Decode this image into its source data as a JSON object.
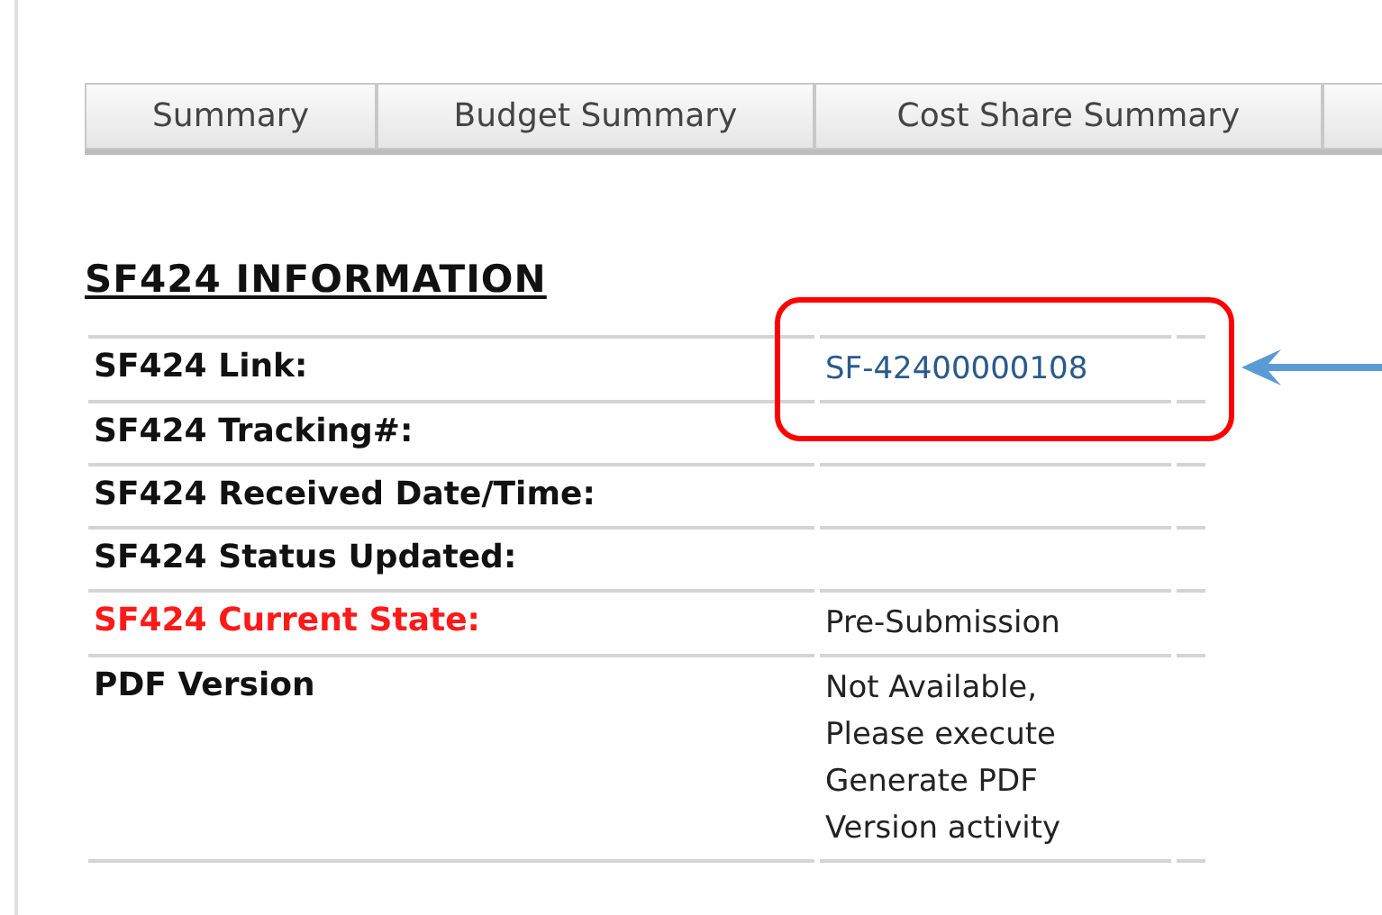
{
  "tabs": [
    {
      "label": "Summary",
      "selected": false
    },
    {
      "label": "Budget Summary",
      "selected": false
    },
    {
      "label": "Cost Share Summary",
      "selected": false
    }
  ],
  "section_title": "SF424 INFORMATION",
  "rows": [
    {
      "label": "SF424 Link:",
      "warning": false,
      "value": "SF-42400000108",
      "link": true,
      "highlighted": true
    },
    {
      "label": "SF424 Tracking#:",
      "warning": false,
      "highlighted": false
    },
    {
      "label": "SF424 Received Date/Time:",
      "warning": false,
      "highlighted": false
    },
    {
      "label": "SF424 Status Updated:",
      "warning": false,
      "highlighted": false
    },
    {
      "label": "SF424 Current State:",
      "warning": true,
      "value": "Pre-Submission",
      "link": false,
      "highlighted": false
    },
    {
      "label": "PDF Version",
      "warning": false,
      "value": "Not Available, Please execute Generate PDF Version activity",
      "link": false,
      "highlighted": false
    }
  ]
}
